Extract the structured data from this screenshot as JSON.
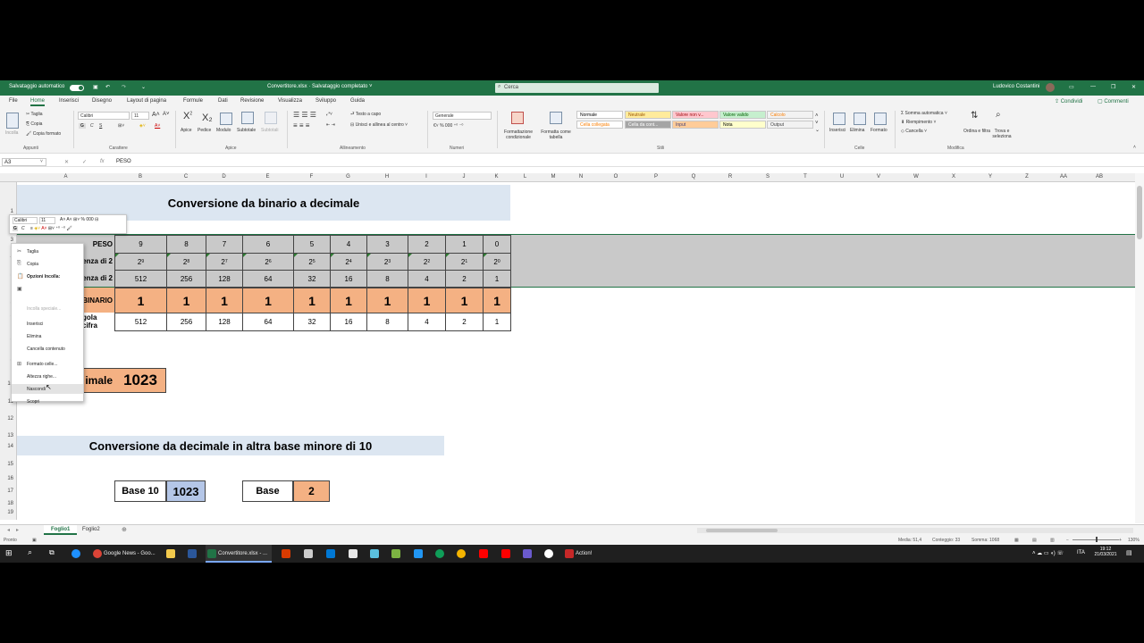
{
  "titlebar": {
    "autosave_label": "Salvataggio automatico",
    "doc_title": "Convertitore.xlsx · Salvataggio completato ˅",
    "search_placeholder": "Cerca",
    "user_name": "Ludovico Costantini",
    "color": "#217346"
  },
  "menu": {
    "tabs": [
      "File",
      "Home",
      "Inserisci",
      "Disegno",
      "Layout di pagina",
      "Formule",
      "Dati",
      "Revisione",
      "Visualizza",
      "Sviluppo",
      "Guida"
    ],
    "active_tab": "Home",
    "share_label": "Condividi",
    "comments_label": "Commenti"
  },
  "ribbon": {
    "clipboard": {
      "label": "Appunti",
      "paste": "Incolla",
      "cut": "Taglia",
      "copy": "Copia",
      "format_painter": "Copia formato"
    },
    "font": {
      "label": "Carattere",
      "family": "Calibri",
      "size": "11"
    },
    "apici": {
      "label": "Apice",
      "items": [
        "Apice",
        "Pedice",
        "Modulo",
        "Subtotale",
        "Subtotali"
      ]
    },
    "alignment": {
      "label": "Allineamento",
      "wrap": "Testo a capo",
      "merge": "Unisci e allinea al centro"
    },
    "number": {
      "label": "Numeri",
      "format": "Generale"
    },
    "styles": {
      "label": "Stili",
      "cond_format": "Formattazione condizionale",
      "table_format": "Formatta come tabella",
      "cells": [
        {
          "name": "Normale",
          "bg": "#ffffff",
          "fg": "#000000"
        },
        {
          "name": "Neutrale",
          "bg": "#ffeb9c",
          "fg": "#9c5700"
        },
        {
          "name": "Valore non v...",
          "bg": "#ffc7ce",
          "fg": "#9c0006"
        },
        {
          "name": "Valore valido",
          "bg": "#c6efce",
          "fg": "#006100"
        },
        {
          "name": "Calcolo",
          "bg": "#f2f2f2",
          "fg": "#fa7d00"
        },
        {
          "name": "Cella collegata",
          "bg": "#ffffff",
          "fg": "#fa7d00"
        },
        {
          "name": "Cella da cont...",
          "bg": "#a5a5a5",
          "fg": "#ffffff"
        },
        {
          "name": "Input",
          "bg": "#ffcc99",
          "fg": "#3f3f76"
        },
        {
          "name": "Nota",
          "bg": "#ffffcc",
          "fg": "#000000"
        },
        {
          "name": "Output",
          "bg": "#f2f2f2",
          "fg": "#3f3f3f"
        }
      ]
    },
    "cells": {
      "label": "Celle",
      "insert": "Inserisci",
      "delete": "Elimina",
      "format": "Formato"
    },
    "editing": {
      "label": "Modifica",
      "autosum": "Somma automatica",
      "fill": "Riempimento",
      "clear": "Cancella",
      "sort": "Ordina e filtra",
      "find": "Trova e seleziona"
    }
  },
  "formula_bar": {
    "name_box": "A3",
    "fx": "fx",
    "value": "PESO"
  },
  "columns": [
    "A",
    "B",
    "C",
    "D",
    "E",
    "F",
    "G",
    "H",
    "I",
    "J",
    "K",
    "L",
    "M",
    "N",
    "O",
    "P",
    "Q",
    "R",
    "S",
    "T",
    "U",
    "V",
    "W",
    "X",
    "Y",
    "Z",
    "AA",
    "AB"
  ],
  "rows": [
    "1",
    "2",
    "3",
    "4",
    "5",
    "6",
    "7",
    "8",
    "9",
    "10",
    "11",
    "12",
    "13",
    "14",
    "15",
    "16",
    "17",
    "18",
    "19"
  ],
  "sheet": {
    "title1": "Conversione da binario a decimale",
    "row_labels": {
      "peso": "PESO",
      "potenza1": "enza di 2",
      "potenza2": "enza di 2",
      "binario": "BINARIO",
      "singola": "gola cifra"
    },
    "pesi": [
      "9",
      "8",
      "7",
      "6",
      "5",
      "4",
      "3",
      "2",
      "1",
      "0"
    ],
    "pow_base": "2",
    "valori": [
      "512",
      "256",
      "128",
      "64",
      "32",
      "16",
      "8",
      "4",
      "2",
      "1"
    ],
    "binario": [
      "1",
      "1",
      "1",
      "1",
      "1",
      "1",
      "1",
      "1",
      "1",
      "1"
    ],
    "singola": [
      "512",
      "256",
      "128",
      "64",
      "32",
      "16",
      "8",
      "4",
      "2",
      "1"
    ],
    "decimale_label": "imale",
    "decimale_value": "1023",
    "title2": "Conversione da decimale in altra base minore di 10",
    "base10_label": "Base 10",
    "base10_value": "1023",
    "base_label": "Base",
    "base_value": "2"
  },
  "mini_toolbar": {
    "font": "Calibri",
    "size": "11"
  },
  "context_menu": [
    {
      "label": "Taglia",
      "icon": "scissors-icon"
    },
    {
      "label": "Copia",
      "icon": "copy-icon"
    },
    {
      "label": "Opzioni Incolla:",
      "icon": "paste-icon",
      "bold": true
    },
    {
      "label": "",
      "icon": "paste-clipboard-icon"
    },
    {
      "label": "Incolla speciale...",
      "disabled": true
    },
    {
      "label": "Inserisci"
    },
    {
      "label": "Elimina"
    },
    {
      "label": "Cancella contenuto"
    },
    {
      "label": "Formato celle...",
      "icon": "format-cells-icon"
    },
    {
      "label": "Altezza righe..."
    },
    {
      "label": "Nascondi",
      "highlight": true
    },
    {
      "label": "Scopri"
    }
  ],
  "sheet_tabs": [
    "Foglio1",
    "Foglio2"
  ],
  "active_sheet": "Foglio1",
  "status": {
    "ready": "Pronto",
    "media": "Media: 51,4",
    "conteggio": "Conteggio: 33",
    "somma": "Somma: 1068",
    "zoom": "130%"
  },
  "taskbar": {
    "apps": [
      "Google News - Goo...",
      "Convertitore.xlsx - ...",
      "Action!"
    ],
    "language": "ITA",
    "time": "19:12",
    "date": "21/03/2021"
  }
}
